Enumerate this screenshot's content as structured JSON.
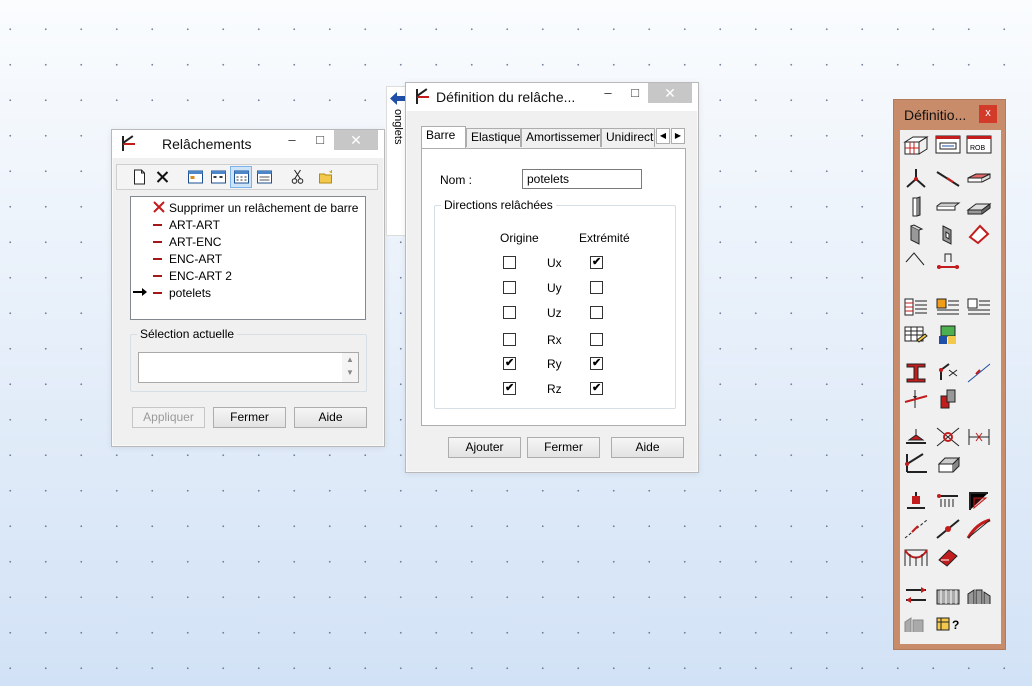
{
  "relachements": {
    "title": "Relâchements",
    "minimize": "–",
    "maximize": "□",
    "close": "✕",
    "list": [
      {
        "label": "Supprimer un relâchement de barre",
        "kind": "delete"
      },
      {
        "label": "ART-ART",
        "kind": "item"
      },
      {
        "label": "ART-ENC",
        "kind": "item"
      },
      {
        "label": "ENC-ART",
        "kind": "item"
      },
      {
        "label": "ENC-ART 2",
        "kind": "item"
      },
      {
        "label": "potelets",
        "kind": "current"
      }
    ],
    "selection_label": "Sélection actuelle",
    "selection_value": "",
    "buttons": {
      "apply": "Appliquer",
      "close": "Fermer",
      "help": "Aide"
    }
  },
  "onglets": {
    "label": "onglets"
  },
  "definition": {
    "title": "Définition du relâche...",
    "minimize": "–",
    "maximize": "□",
    "close": "✕",
    "tabs": [
      "Barre",
      "Elastique",
      "Amortissement",
      "Unidirectio"
    ],
    "active_tab": "Barre",
    "name_label": "Nom :",
    "name_value": "potelets",
    "group_label": "Directions relâchées",
    "col_origin": "Origine",
    "col_end": "Extrémité",
    "rows": [
      {
        "dof": "Ux",
        "origin": false,
        "end": true
      },
      {
        "dof": "Uy",
        "origin": false,
        "end": false
      },
      {
        "dof": "Uz",
        "origin": false,
        "end": false
      },
      {
        "dof": "Rx",
        "origin": false,
        "end": false
      },
      {
        "dof": "Ry",
        "origin": true,
        "end": true
      },
      {
        "dof": "Rz",
        "origin": true,
        "end": true
      }
    ],
    "buttons": {
      "add": "Ajouter",
      "close": "Fermer",
      "help": "Aide"
    }
  },
  "toolbox": {
    "title": "Définitio...",
    "close": "x",
    "rob_label": "ROB",
    "help_mark": "?"
  },
  "colors": {
    "accent_red": "#c31c1c",
    "toolbox_frame": "#c98c6b",
    "arrow_blue": "#1f4fa8"
  }
}
